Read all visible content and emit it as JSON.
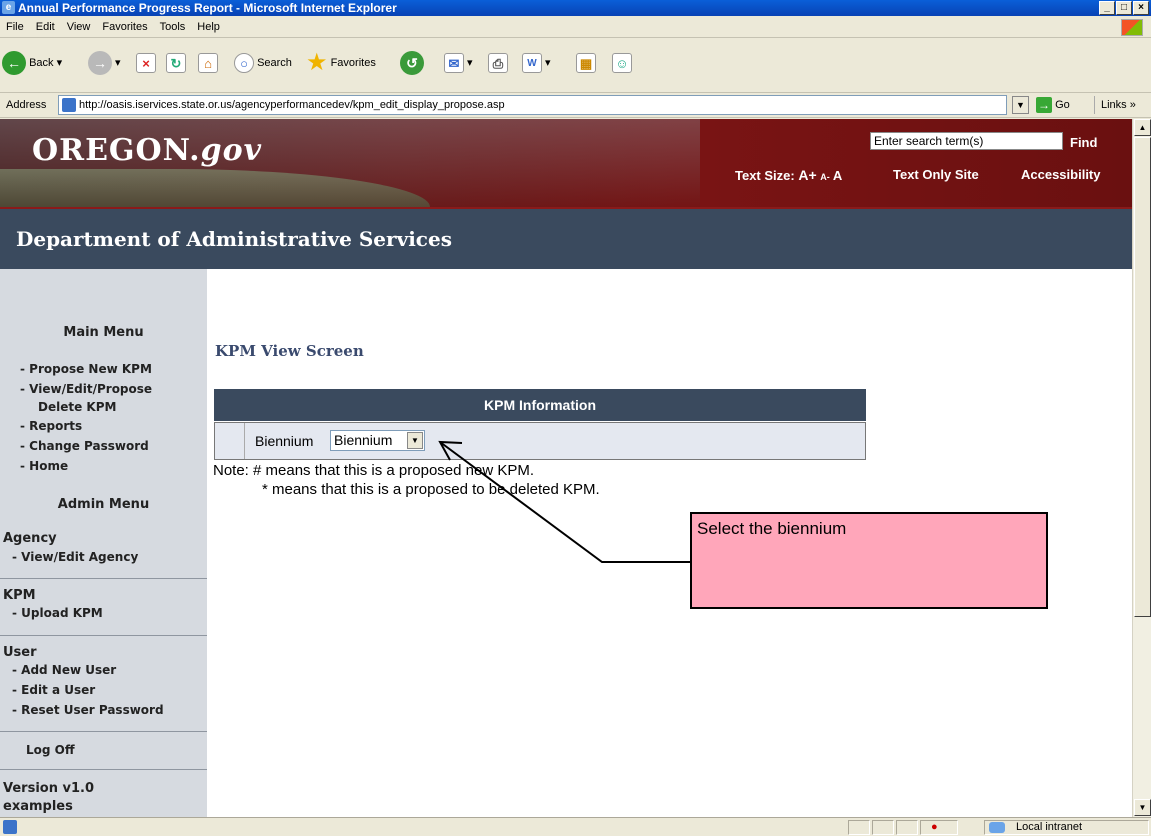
{
  "window": {
    "title": "Annual Performance Progress Report - Microsoft Internet Explorer",
    "buttons": {
      "minimize": "_",
      "maximize": "×",
      "close": "×"
    }
  },
  "menubar": [
    "File",
    "Edit",
    "View",
    "Favorites",
    "Tools",
    "Help"
  ],
  "toolbar": {
    "back": "Back",
    "search": "Search",
    "favorites": "Favorites"
  },
  "addressbar": {
    "label": "Address",
    "url": "http://oasis.iservices.state.or.us/agencyperformancedev/kpm_edit_display_propose.asp",
    "go": "Go",
    "links": "Links"
  },
  "site": {
    "logo_main": "OREGON.",
    "logo_gov": "gov",
    "search_placeholder": "Enter search term(s)",
    "find": "Find",
    "text_size_label": "Text Size:",
    "text_size_big": "A+",
    "text_size_small": "A-",
    "text_size_normal": "A",
    "text_only": "Text Only Site",
    "accessibility": "Accessibility",
    "department": "Department of Administrative Services"
  },
  "leftnav": {
    "main_menu": "Main Menu",
    "main_items": [
      "- Propose New KPM",
      "- View/Edit/Propose",
      "Delete KPM",
      "- Reports",
      "- Change Password",
      "- Home"
    ],
    "admin_menu": "Admin Menu",
    "agency": "Agency",
    "agency_items": [
      "- View/Edit Agency"
    ],
    "kpm": "KPM",
    "kpm_items": [
      "- Upload KPM"
    ],
    "user": "User",
    "user_items": [
      "- Add New User",
      "- Edit a User",
      "- Reset User Password"
    ],
    "logoff": "Log Off",
    "version": "Version v1.0",
    "trailing": "examples"
  },
  "main": {
    "page_title": "KPM View Screen",
    "table_header": "KPM Information",
    "biennium_label": "Biennium",
    "biennium_value": "Biennium",
    "note1": "Note: # means that this is a proposed new KPM.",
    "note2": "* means that this is a proposed to be deleted KPM."
  },
  "callout": {
    "text": "Select the biennium",
    "color": "#ffa6ba"
  },
  "statusbar": {
    "zone": "Local intranet"
  }
}
